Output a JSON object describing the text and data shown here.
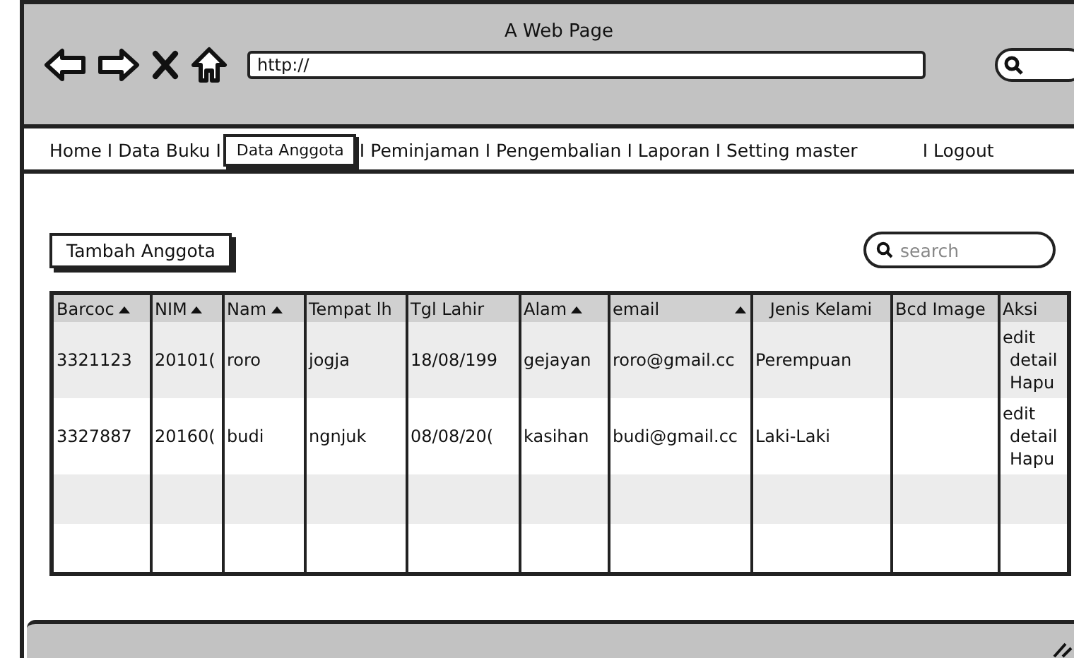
{
  "window": {
    "title": "A Web Page",
    "url": "http://"
  },
  "nav": [
    {
      "kind": "link",
      "label": "Home",
      "selected": false
    },
    {
      "kind": "separator",
      "label": "I"
    },
    {
      "kind": "link",
      "label": "Data Buku",
      "selected": false
    },
    {
      "kind": "separator",
      "label": "I"
    },
    {
      "kind": "link",
      "label": "Data Anggota",
      "selected": true
    },
    {
      "kind": "separator",
      "label": "I"
    },
    {
      "kind": "link",
      "label": "Peminjaman",
      "selected": false
    },
    {
      "kind": "separator",
      "label": "I"
    },
    {
      "kind": "link",
      "label": "Pengembalian",
      "selected": false
    },
    {
      "kind": "separator",
      "label": "I"
    },
    {
      "kind": "link",
      "label": "Laporan",
      "selected": false
    },
    {
      "kind": "separator",
      "label": "I"
    },
    {
      "kind": "link",
      "label": "Setting master",
      "selected": false
    },
    {
      "kind": "spacer"
    },
    {
      "kind": "separator",
      "label": "I"
    },
    {
      "kind": "link",
      "label": "Logout",
      "selected": false
    }
  ],
  "add_button": "Tambah Anggota",
  "search": {
    "placeholder": "search"
  },
  "table": {
    "columns": [
      {
        "label": "Barcoc",
        "sorted": true
      },
      {
        "label": "NIM",
        "sorted": true
      },
      {
        "label": "Nam",
        "sorted": true
      },
      {
        "label": "Tempat lh",
        "sorted": false
      },
      {
        "label": "Tgl Lahir",
        "sorted": false
      },
      {
        "label": "Alam",
        "sorted": true
      },
      {
        "label": "email",
        "sorted": true
      },
      {
        "label": "Jenis Kelami",
        "sorted": false
      },
      {
        "label": "Bcd Image",
        "sorted": false
      },
      {
        "label": "Aksi",
        "sorted": false
      }
    ],
    "rows": [
      {
        "cells": [
          "3321123",
          "20101(",
          "roro",
          "jogja",
          "18/08/199",
          "gejayan",
          "roro@gmail.cc",
          "Perempuan"
        ],
        "actions": [
          "edit",
          "detail",
          "Hapu"
        ]
      },
      {
        "cells": [
          "3327887",
          "20160(",
          "budi",
          "ngnjuk",
          "08/08/20(",
          "kasihan",
          "budi@gmail.cc",
          "Laki-Laki"
        ],
        "actions": [
          "edit",
          "detail",
          "Hapu"
        ]
      }
    ]
  }
}
